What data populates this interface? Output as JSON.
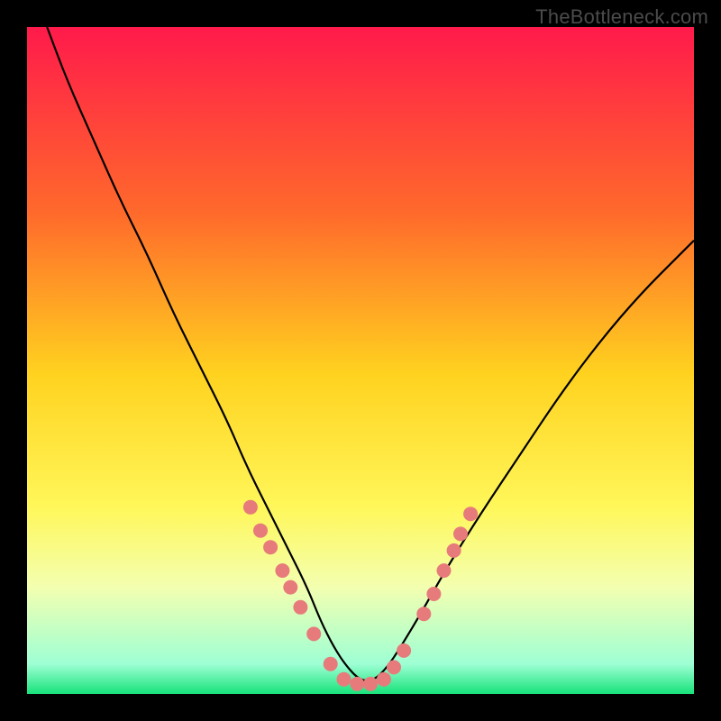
{
  "watermark": "TheBottleneck.com",
  "chart_data": {
    "type": "line",
    "title": "",
    "xlabel": "",
    "ylabel": "",
    "xlim": [
      0,
      100
    ],
    "ylim": [
      0,
      100
    ],
    "grid": false,
    "legend": false,
    "background_gradient_stops": [
      {
        "offset": 0.0,
        "color": "#ff1a4b"
      },
      {
        "offset": 0.28,
        "color": "#ff6a2b"
      },
      {
        "offset": 0.52,
        "color": "#ffd21f"
      },
      {
        "offset": 0.72,
        "color": "#fff75a"
      },
      {
        "offset": 0.84,
        "color": "#f3ffb0"
      },
      {
        "offset": 0.955,
        "color": "#9effd4"
      },
      {
        "offset": 1.0,
        "color": "#18e27a"
      }
    ],
    "series": [
      {
        "name": "bottleneck-curve",
        "x": [
          3,
          6,
          10,
          14,
          18,
          22,
          26,
          30,
          33,
          36,
          39,
          42,
          44,
          46,
          48,
          50,
          52,
          54,
          56,
          59,
          63,
          68,
          74,
          80,
          86,
          92,
          98,
          100
        ],
        "y": [
          100,
          92,
          83,
          74,
          66,
          57,
          49,
          41,
          34,
          28,
          22,
          16,
          11,
          7,
          4,
          2,
          2,
          4,
          7,
          12,
          19,
          27,
          36,
          45,
          53,
          60,
          66,
          68
        ]
      }
    ],
    "markers": {
      "name": "highlight-points",
      "color": "#e77b7b",
      "radius": 8,
      "points": [
        {
          "x": 33.5,
          "y": 28.0
        },
        {
          "x": 35.0,
          "y": 24.5
        },
        {
          "x": 36.5,
          "y": 22.0
        },
        {
          "x": 38.3,
          "y": 18.5
        },
        {
          "x": 39.5,
          "y": 16.0
        },
        {
          "x": 41.0,
          "y": 13.0
        },
        {
          "x": 43.0,
          "y": 9.0
        },
        {
          "x": 45.5,
          "y": 4.5
        },
        {
          "x": 47.5,
          "y": 2.2
        },
        {
          "x": 49.5,
          "y": 1.5
        },
        {
          "x": 51.5,
          "y": 1.5
        },
        {
          "x": 53.5,
          "y": 2.2
        },
        {
          "x": 55.0,
          "y": 4.0
        },
        {
          "x": 56.5,
          "y": 6.5
        },
        {
          "x": 59.5,
          "y": 12.0
        },
        {
          "x": 61.0,
          "y": 15.0
        },
        {
          "x": 62.5,
          "y": 18.5
        },
        {
          "x": 64.0,
          "y": 21.5
        },
        {
          "x": 65.0,
          "y": 24.0
        },
        {
          "x": 66.5,
          "y": 27.0
        }
      ]
    }
  }
}
